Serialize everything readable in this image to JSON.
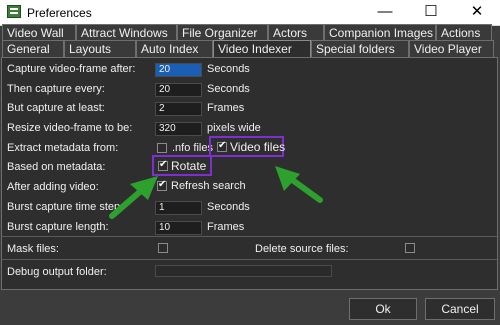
{
  "window": {
    "title": "Preferences",
    "minimize_glyph": "—",
    "maximize_glyph": "☐",
    "close_glyph": "✕"
  },
  "tabs_top": [
    "Video Wall",
    "Attract Windows",
    "File Organizer",
    "Actors",
    "Companion Images",
    "Actions"
  ],
  "tabs_bottom": [
    "General",
    "Layouts",
    "Auto Index",
    "Video Indexer",
    "Special folders",
    "Video Player"
  ],
  "active_tab": "Video Indexer",
  "form": {
    "capture_after": {
      "label": "Capture video-frame after:",
      "value": "20",
      "unit": "Seconds"
    },
    "then_capture": {
      "label": "Then capture every:",
      "value": "20",
      "unit": "Seconds"
    },
    "capture_least": {
      "label": "But capture at least:",
      "value": "2",
      "unit": "Frames"
    },
    "resize": {
      "label": "Resize video-frame to be:",
      "value": "320",
      "unit": "pixels wide"
    },
    "extract": {
      "label": "Extract metadata from:",
      "nfo_label": ".nfo files",
      "nfo_checked": false,
      "video_label": "Video files",
      "video_checked": true
    },
    "based": {
      "label": "Based on metadata:",
      "rotate_label": "Rotate",
      "rotate_checked": true
    },
    "after_adding": {
      "label": "After adding video:",
      "refresh_label": "Refresh search",
      "refresh_checked": true
    },
    "burst_time": {
      "label": "Burst capture time step:",
      "value": "1",
      "unit": "Seconds"
    },
    "burst_length": {
      "label": "Burst capture length:",
      "value": "10",
      "unit": "Frames"
    },
    "mask": {
      "label": "Mask files:",
      "checked": false
    },
    "delete_source": {
      "label": "Delete source files:",
      "checked": false
    },
    "debug": {
      "label": "Debug output folder:",
      "value": ""
    }
  },
  "buttons": {
    "ok": "Ok",
    "cancel": "Cancel"
  },
  "colors": {
    "highlight_border": "#7e2fd0",
    "arrow": "#2ea02e",
    "selected_field": "#1a5fb4"
  }
}
